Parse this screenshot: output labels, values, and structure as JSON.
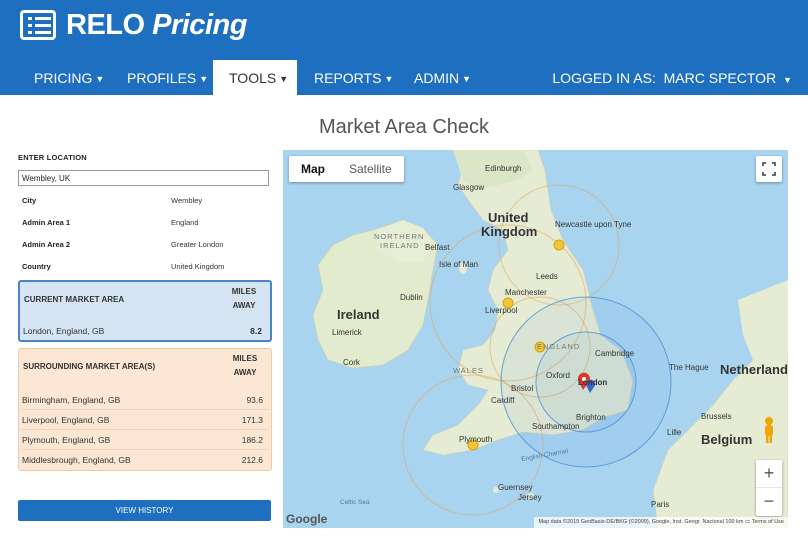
{
  "app": {
    "brand_first": "RELO",
    "brand_second": "Pricing",
    "accent_color": "#1e6fc0"
  },
  "nav": {
    "items": [
      {
        "label": "PRICING"
      },
      {
        "label": "PROFILES"
      },
      {
        "label": "TOOLS"
      },
      {
        "label": "REPORTS"
      },
      {
        "label": "ADMIN"
      }
    ],
    "active": "TOOLS",
    "user_label": "LOGGED IN AS:",
    "user_name": "MARC SPECTOR"
  },
  "page": {
    "title": "Market Area Check"
  },
  "location": {
    "label": "ENTER LOCATION",
    "value": "Wembley, UK",
    "fields": [
      {
        "key": "City",
        "value": "Wembley"
      },
      {
        "key": "Admin Area 1",
        "value": "England"
      },
      {
        "key": "Admin Area 2",
        "value": "Greater London"
      },
      {
        "key": "Country",
        "value": "United Kingdom"
      }
    ]
  },
  "current_market": {
    "header": "CURRENT MARKET AREA",
    "miles_header_line1": "MILES",
    "miles_header_line2": "AWAY",
    "name": "London, England, GB",
    "miles": "8.2"
  },
  "surrounding": {
    "header": "SURROUNDING MARKET AREA(S)",
    "miles_header_line1": "MILES",
    "miles_header_line2": "AWAY",
    "rows": [
      {
        "name": "Birmingham, England, GB",
        "miles": "93.6"
      },
      {
        "name": "Liverpool, England, GB",
        "miles": "171.3"
      },
      {
        "name": "Plymouth, England, GB",
        "miles": "186.2"
      },
      {
        "name": "Middlesbrough, England, GB",
        "miles": "212.6"
      }
    ]
  },
  "buttons": {
    "view_history": "VIEW HISTORY"
  },
  "map": {
    "toggle_map": "Map",
    "toggle_satellite": "Satellite",
    "zoom_in": "+",
    "zoom_out": "−",
    "google": "Google",
    "attribution": "Map data ©2019 GeoBasis-DE/BKG (©2009), Google, Inst. Geogr. Nacional   100 km ▭   Terms of Use",
    "labels": {
      "united_kingdom_1": "United",
      "united_kingdom_2": "Kingdom",
      "ireland": "Ireland",
      "northern_ireland_1": "NORTHERN",
      "northern_ireland_2": "IRELAND",
      "netherlands": "Netherlands",
      "belgium": "Belgium",
      "england": "ENGLAND",
      "wales": "WALES",
      "edinburgh": "Edinburgh",
      "glasgow": "Glasgow",
      "newcastle": "Newcastle\nupon Tyne",
      "belfast": "Belfast",
      "isle_of_man": "Isle of Man",
      "leeds": "Leeds",
      "manchester": "Manchester",
      "liverpool": "Liverpool",
      "dublin": "Dublin",
      "limerick": "Limerick",
      "cork": "Cork",
      "cambridge": "Cambridge",
      "oxford": "Oxford",
      "london": "London",
      "bristol": "Bristol",
      "cardiff": "Cardiff",
      "southampton": "Southampton",
      "brighton": "Brighton",
      "plymouth": "Plymouth",
      "the_hague": "The Hague",
      "brussels": "Brussels",
      "lille": "Lille",
      "paris": "Paris",
      "guernsey": "Guernsey",
      "jersey": "Jersey",
      "celtic_sea": "Celtic Sea",
      "english_channel": "English Channel"
    }
  }
}
